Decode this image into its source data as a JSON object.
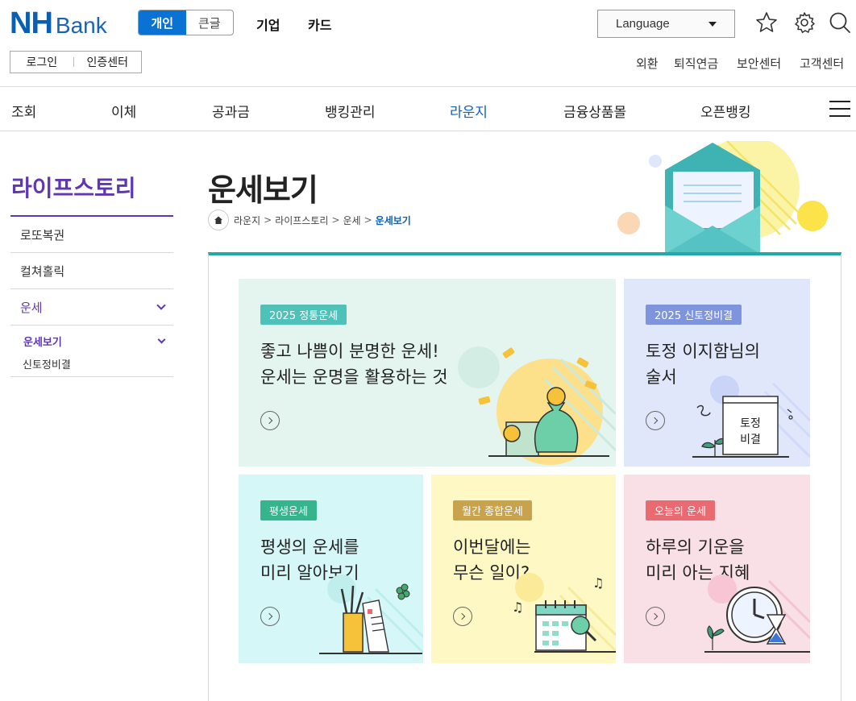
{
  "header": {
    "logo_nh": "NH",
    "logo_bank": "Bank",
    "segment": {
      "personal": "개인",
      "gold": "큰글"
    },
    "top_menu": [
      "기업",
      "카드"
    ],
    "language": "Language",
    "login": "로그인",
    "cert_center": "인증센터",
    "util_links": [
      "외환",
      "퇴직연금",
      "보안센터",
      "고객센터"
    ]
  },
  "main_nav": [
    "조회",
    "이체",
    "공과금",
    "뱅킹관리",
    "라운지",
    "금융상품몰",
    "오픈뱅킹"
  ],
  "sidebar": {
    "title": "라이프스토리",
    "items": [
      "로또복권",
      "컬쳐홀릭",
      "운세"
    ],
    "sub_items": [
      "운세보기",
      "신토정비결"
    ]
  },
  "page": {
    "title": "운세보기",
    "breadcrumb": [
      "라운지",
      "라이프스토리",
      "운세",
      "운세보기"
    ]
  },
  "cards": [
    {
      "tag": "2025 정통운세",
      "line1": "좋고 나쁨이 분명한 운세!",
      "line2": "운세는 운명을 활용하는 것",
      "bg": "#e4f4ef",
      "tag_color": "#4fc1b8"
    },
    {
      "tag": "2025 신토정비결",
      "line1": "토정 이지함님의",
      "line2": "술서",
      "bg": "#e1e7fb",
      "tag_color": "#7e94dc",
      "book_line1": "토정",
      "book_line2": "비결"
    },
    {
      "tag": "평생운세",
      "line1": "평생의 운세를",
      "line2": "미리 알아보기",
      "bg": "#d6f7f8",
      "tag_color": "#36b48b"
    },
    {
      "tag": "월간 종합운세",
      "line1": "이번달에는",
      "line2": "무슨 일이?",
      "bg": "#fdf8c4",
      "tag_color": "#c9a24e"
    },
    {
      "tag": "오늘의 운세",
      "line1": "하루의 기운을",
      "line2": "미리 아는 지혜",
      "bg": "#f9dfe6",
      "tag_color": "#ea6a71"
    }
  ],
  "colors": {
    "brand": "#0a5fb4",
    "lnb_accent": "#5f38b1",
    "panel_accent": "#25a7a8"
  }
}
